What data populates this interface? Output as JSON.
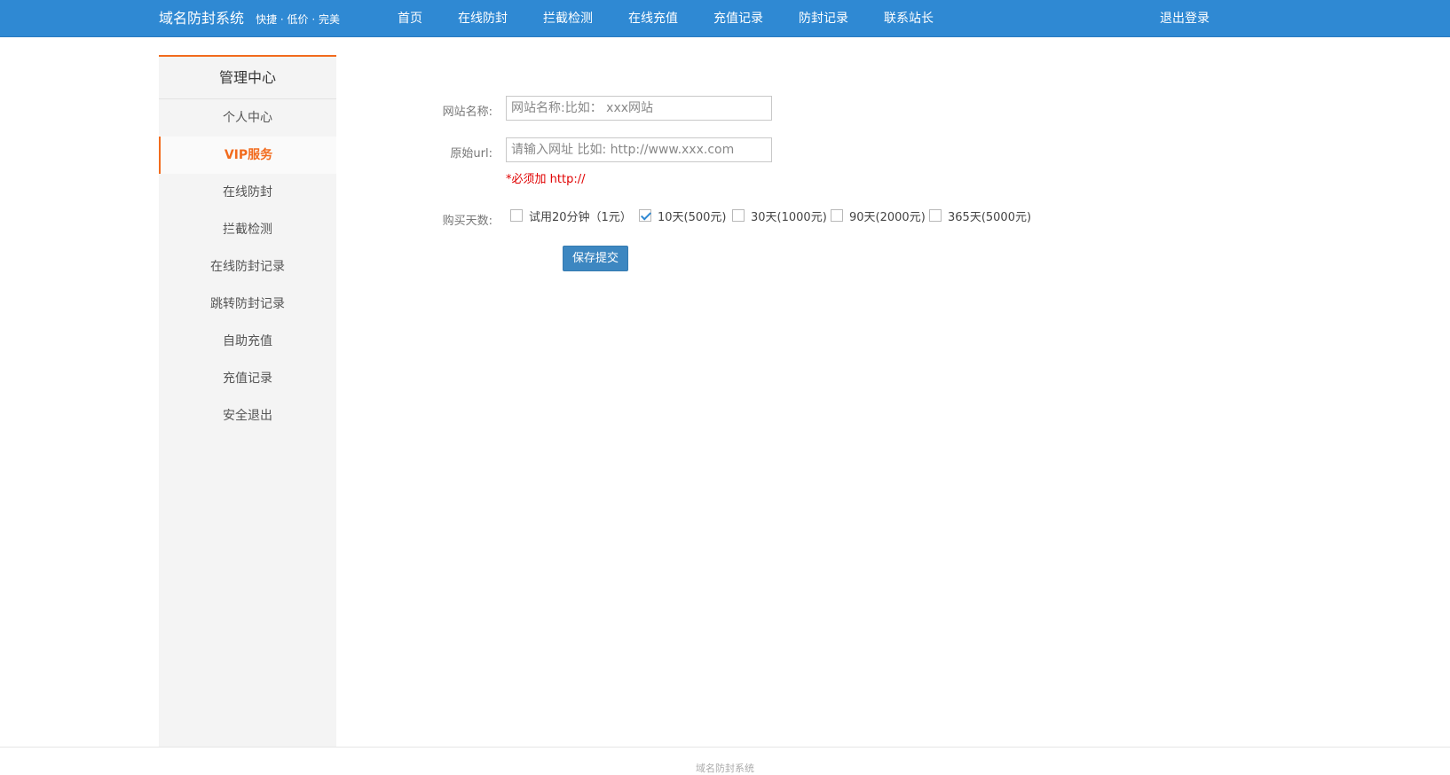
{
  "header": {
    "brand_title": "域名防封系统",
    "brand_slogan": "快捷 · 低价 · 完美",
    "nav": [
      "首页",
      "在线防封",
      "拦截检测",
      "在线充值",
      "充值记录",
      "防封记录",
      "联系站长"
    ],
    "logout": "退出登录",
    "bg_color": "#2f89d3"
  },
  "sidebar": {
    "title": "管理中心",
    "items": [
      {
        "label": "个人中心",
        "active": false
      },
      {
        "label": "VIP服务",
        "active": true
      },
      {
        "label": "在线防封",
        "active": false
      },
      {
        "label": "拦截检测",
        "active": false
      },
      {
        "label": "在线防封记录",
        "active": false
      },
      {
        "label": "跳转防封记录",
        "active": false
      },
      {
        "label": "自助充值",
        "active": false
      },
      {
        "label": "充值记录",
        "active": false
      },
      {
        "label": "安全退出",
        "active": false
      }
    ],
    "accent_color": "#f26b1d"
  },
  "form": {
    "site_name": {
      "label": "网站名称:",
      "value": "",
      "placeholder": "网站名称:比如： xxx网站"
    },
    "origin_url": {
      "label": "原始url:",
      "value": "",
      "placeholder": "请输入网址 比如: http://www.xxx.com",
      "hint": "*必须加 http://"
    },
    "days": {
      "label": "购买天数:",
      "options": [
        {
          "label": "试用20分钟（1元）",
          "checked": false
        },
        {
          "label": "10天(500元)",
          "checked": true
        },
        {
          "label": "30天(1000元)",
          "checked": false
        },
        {
          "label": "90天(2000元)",
          "checked": false
        },
        {
          "label": "365天(5000元)",
          "checked": false
        }
      ]
    },
    "submit": "保存提交"
  },
  "footer": {
    "text": "域名防封系统"
  }
}
